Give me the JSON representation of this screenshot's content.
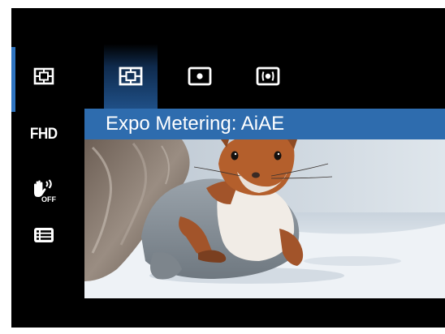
{
  "title_bar": {
    "text": "Expo Metering: AiAE"
  },
  "sidebar": {
    "items": [
      {
        "icon": "metering-aiae-icon",
        "selected": true
      },
      {
        "icon": "fhd-icon",
        "label": "FHD"
      },
      {
        "icon": "stabilizer-off-icon"
      },
      {
        "icon": "menu-list-icon"
      }
    ]
  },
  "options": [
    {
      "icon": "metering-aiae-icon",
      "selected": true
    },
    {
      "icon": "metering-spot-icon",
      "selected": false
    },
    {
      "icon": "metering-center-weighted-icon",
      "selected": false
    }
  ],
  "live_view": {
    "subject": "red-squirrel-in-snow"
  },
  "colors": {
    "screen_bg": "#000000",
    "accent": "#2f74c0",
    "title_bar_bg": "#2e6cae",
    "selected_option_gradient_end": "#1f4f86",
    "icon": "#ffffff"
  }
}
